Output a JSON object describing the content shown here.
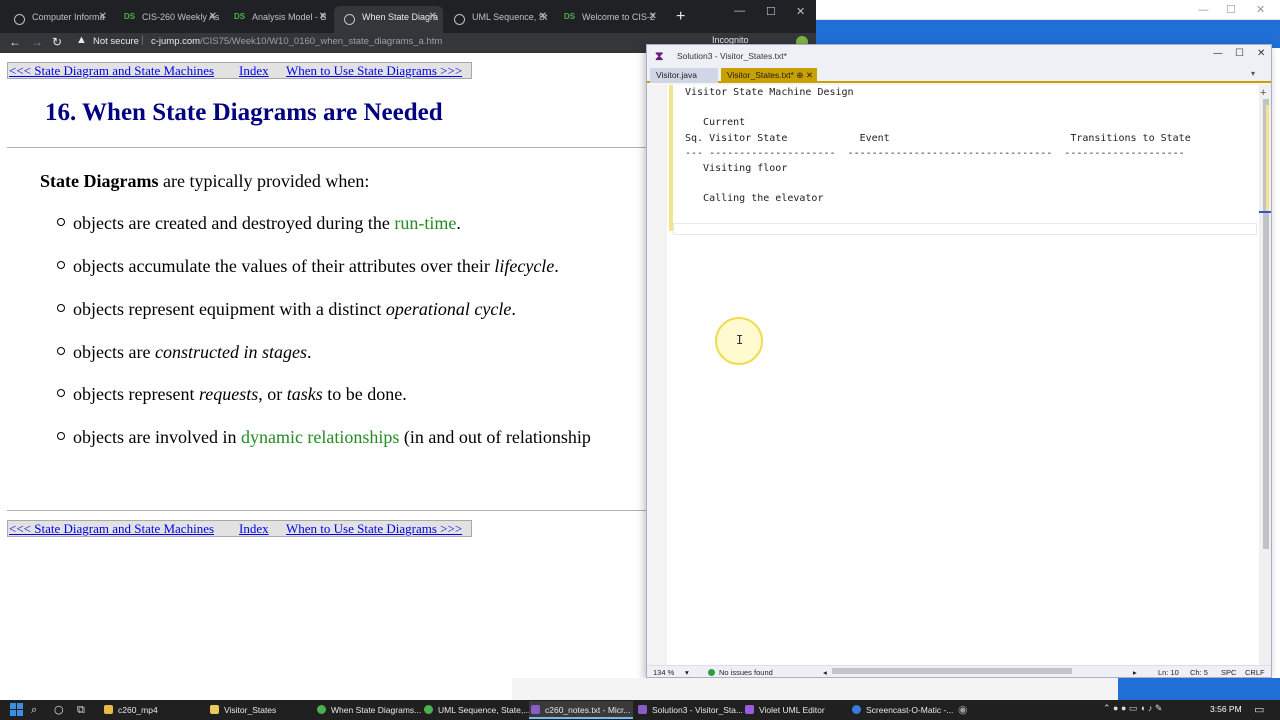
{
  "background_window": {
    "minimize": "—",
    "maximize": "☐",
    "close": "✕"
  },
  "browser": {
    "tabs": [
      {
        "label": "Computer Informa",
        "icon": "globe-icon"
      },
      {
        "label": "CIS-260 Weekly As",
        "icon": "ds-icon"
      },
      {
        "label": "Analysis Model - B",
        "icon": "ds-icon"
      },
      {
        "label": "When State Diagra",
        "icon": "globe-icon",
        "active": true
      },
      {
        "label": "UML Sequence, St",
        "icon": "globe-icon"
      },
      {
        "label": "Welcome to CIS-2",
        "icon": "ds-icon"
      }
    ],
    "new_tab": "+",
    "window_controls": {
      "minimize": "—",
      "maximize": "☐",
      "close": "✕"
    },
    "nav": {
      "back": "←",
      "forward": "→",
      "reload": "↻"
    },
    "security_label": "Not secure",
    "url_domain": "c-jump.com",
    "url_path": "/CIS75/Week10/W10_0160_when_state_diagrams_a.htm",
    "incognito": "Incognito"
  },
  "page": {
    "nav_top": {
      "prev": "<<< State Diagram and State Machines",
      "index": "Index",
      "next": "When to Use State Diagrams >>>"
    },
    "title": "16. When State Diagrams are Needed",
    "intro_bold": "State Diagrams",
    "intro_rest": " are typically provided when:",
    "bullets": [
      {
        "pre": "objects are created and destroyed during the ",
        "hl": "run-time",
        "post": "."
      },
      {
        "pre": "objects accumulate the values of their attributes over their ",
        "it": "lifecycle",
        "post": "."
      },
      {
        "pre": "objects represent equipment with a distinct ",
        "it": "operational cycle",
        "post": "."
      },
      {
        "pre": "objects are ",
        "it": "constructed in stages",
        "post": "."
      },
      {
        "pre": "objects represent ",
        "it": "requests",
        "mid": ", or ",
        "it2": "tasks",
        "post": " to be done."
      },
      {
        "pre": "objects are involved in ",
        "hl": "dynamic relationships",
        "post": " (in and out of relationship"
      }
    ],
    "nav_bottom": {
      "prev": "<<< State Diagram and State Machines",
      "index": "Index",
      "next": "When to Use State Diagrams >>>"
    }
  },
  "vs": {
    "logo": "⧗",
    "title": "Solution3 - Visitor_States.txt*",
    "window_controls": {
      "minimize": "—",
      "maximize": "☐",
      "close": "✕"
    },
    "tabs": [
      {
        "label": "Visitor.java"
      },
      {
        "label": "Visitor_States.txt*",
        "pin": "⊕",
        "close": "✕",
        "active": true
      }
    ],
    "tabs_dropdown": "▾",
    "editor_plus": "+",
    "code": "Visitor State Machine Design\n\n   Current\nSq. Visitor State            Event                              Transitions to State\n--- ---------------------  ----------------------------------  --------------------\n   Visiting floor\n\n   Calling the elevator\n\n",
    "status": {
      "zoom": "134 %",
      "zoom_dd": "▾",
      "issues": "No issues found",
      "scroll_left": "◂",
      "scroll_right": "▸",
      "line": "Ln: 10",
      "col": "Ch: 5",
      "spc": "SPC",
      "eol": "CRLF"
    }
  },
  "taskbar": {
    "items": [
      {
        "label": "c260_mp4",
        "color": "#e8b84a"
      },
      {
        "label": "Visitor_States",
        "color": "#e8c95a"
      },
      {
        "label": "When State Diagrams...",
        "color": "#4caf50"
      },
      {
        "label": "UML Sequence, State,...",
        "color": "#4caf50"
      },
      {
        "label": "c260_notes.txt - Micr...",
        "color": "#8a5cc7",
        "active": true
      },
      {
        "label": "Solution3 - Visitor_Sta...",
        "color": "#8a5cc7"
      },
      {
        "label": "Violet UML Editor",
        "color": "#9c5ce0"
      },
      {
        "label": "Screencast-O-Matic -...",
        "color": "#3a7be0"
      }
    ],
    "tray": "⌃  ●  ●  ▭  ◖ ♪  ✎",
    "clock": "3:56 PM"
  },
  "colors": {
    "title_blue": "#000080",
    "link_green": "#228b22",
    "vs_accent": "#c8a000",
    "chrome_dark": "#202124"
  }
}
